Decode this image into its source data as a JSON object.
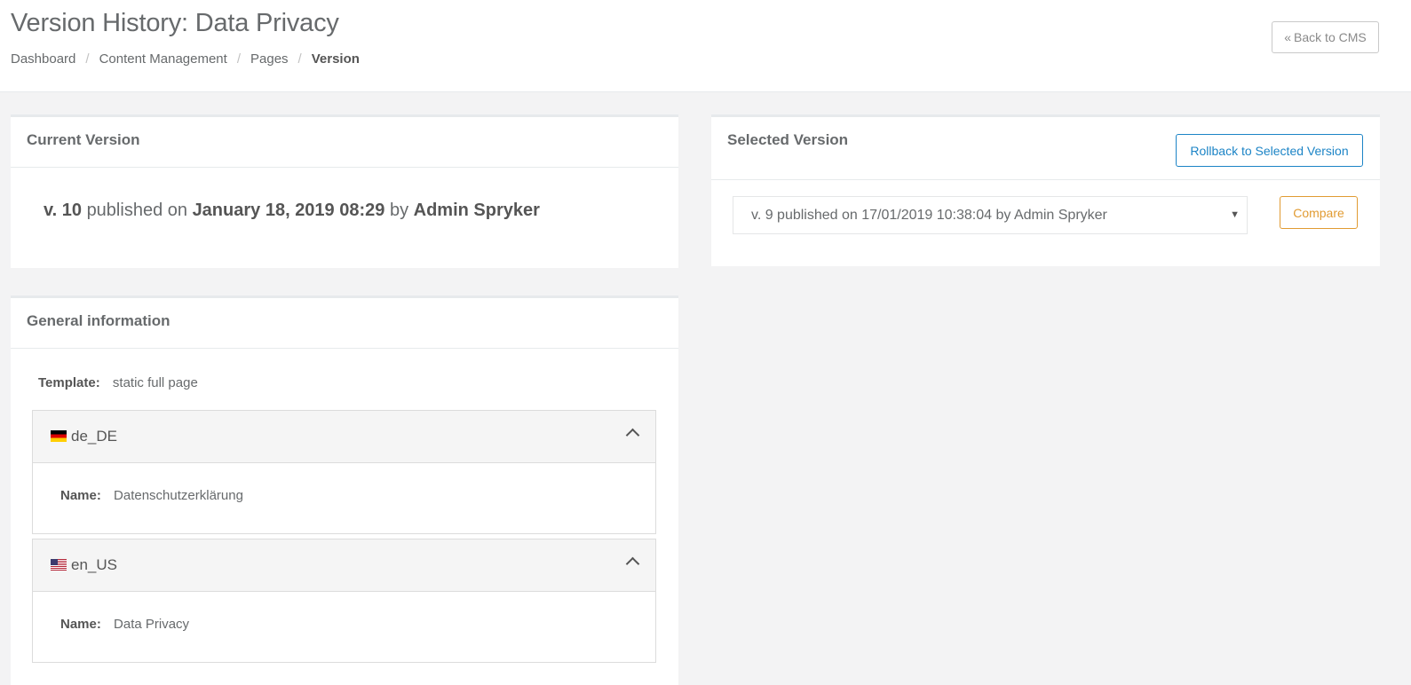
{
  "header": {
    "title": "Version History: Data Privacy",
    "breadcrumb": [
      "Dashboard",
      "Content Management",
      "Pages",
      "Version"
    ],
    "back_button": "Back to CMS"
  },
  "current_version": {
    "title": "Current Version",
    "version": "v. 10",
    "published_text": "published on",
    "date": "January 18, 2019 08:29",
    "by_text": "by",
    "author": "Admin Spryker"
  },
  "selected_version": {
    "title": "Selected Version",
    "rollback_button": "Rollback to Selected Version",
    "select_value": "v. 9 published on 17/01/2019 10:38:04 by Admin Spryker",
    "compare_button": "Compare"
  },
  "general_info": {
    "title": "General information",
    "template_label": "Template:",
    "template_value": "static full page",
    "locales": [
      {
        "code": "de_DE",
        "flag": "de-flag-icon",
        "name_label": "Name:",
        "name_value": "Datenschutzerklärung"
      },
      {
        "code": "en_US",
        "flag": "us-flag-icon",
        "name_label": "Name:",
        "name_value": "Data Privacy"
      }
    ]
  },
  "colors": {
    "primary_blue": "#1c84c6",
    "compare_orange": "#e19b32",
    "text": "#676a6c",
    "background": "#f3f3f4"
  }
}
